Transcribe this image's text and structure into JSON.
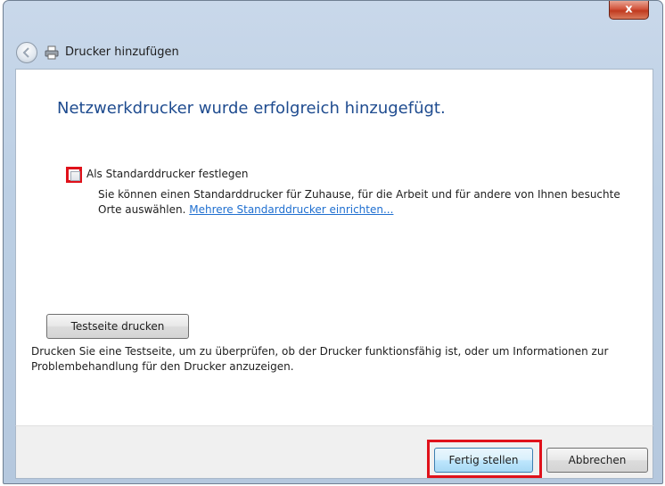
{
  "window": {
    "title": "Drucker hinzufügen",
    "close_label": "x"
  },
  "content": {
    "heading": "Netzwerkdrucker wurde erfolgreich hinzugefügt.",
    "default_checkbox": {
      "label": "Als Standarddrucker festlegen",
      "checked": false
    },
    "description": "Sie können einen Standarddrucker für Zuhause, für die Arbeit und für andere von Ihnen besuchte Orte auswählen.",
    "link_text": "Mehrere Standarddrucker einrichten...",
    "info_text": "Drucken Sie eine Testseite, um zu überprüfen, ob der Drucker funktionsfähig ist, oder um Informationen zur Problembehandlung für den Drucker anzuzeigen.",
    "test_button_label": "Testseite drucken"
  },
  "footer": {
    "finish_label": "Fertig stellen",
    "cancel_label": "Abbrechen"
  },
  "colors": {
    "heading": "#1e4b8f",
    "link": "#1f6fd0",
    "highlight": "#e0111a"
  }
}
